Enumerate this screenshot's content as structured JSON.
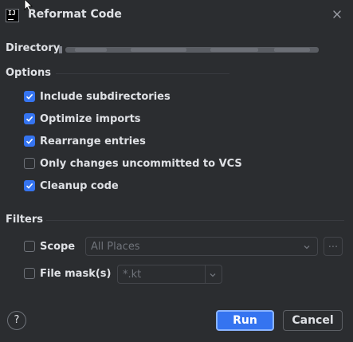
{
  "window": {
    "title": "Reformat Code",
    "app_icon_text": "IJ"
  },
  "directory": {
    "label": "Directory"
  },
  "options": {
    "heading": "Options",
    "items": [
      {
        "label": "Include subdirectories",
        "checked": true
      },
      {
        "label": "Optimize imports",
        "checked": true
      },
      {
        "label": "Rearrange entries",
        "checked": true
      },
      {
        "label": "Only changes uncommitted to VCS",
        "checked": false
      },
      {
        "label": "Cleanup code",
        "checked": true
      }
    ]
  },
  "filters": {
    "heading": "Filters",
    "scope": {
      "label": "Scope",
      "checked": false,
      "value": "All Places",
      "more_label": "..."
    },
    "file_mask": {
      "label": "File mask(s)",
      "checked": false,
      "value": "*.kt"
    }
  },
  "buttons": {
    "help": "?",
    "run": "Run",
    "cancel": "Cancel"
  },
  "colors": {
    "background": "#2b2d30",
    "accent": "#3574f0",
    "text": "#dfe1e5",
    "disabled_text": "#6f737a"
  }
}
